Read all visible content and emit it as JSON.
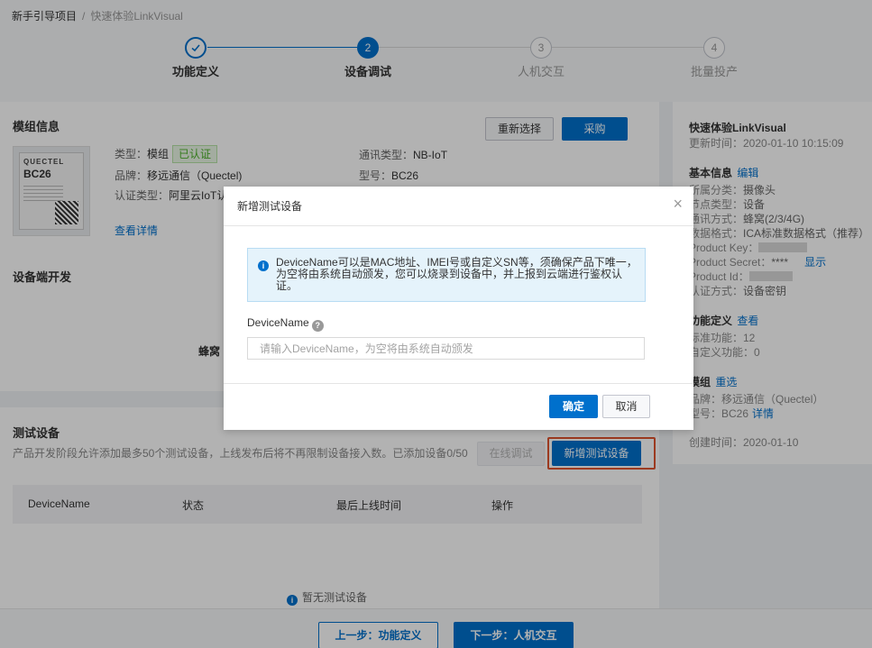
{
  "breadcrumb": {
    "project": "新手引导项目",
    "separator": "/",
    "current": "快速体验LinkVisual"
  },
  "steps": [
    {
      "num": "",
      "label": "功能定义",
      "state": "done"
    },
    {
      "num": "2",
      "label": "设备调试",
      "state": "active"
    },
    {
      "num": "3",
      "label": "人机交互",
      "state": "todo"
    },
    {
      "num": "4",
      "label": "批量投产",
      "state": "todo"
    }
  ],
  "module": {
    "title": "模组信息",
    "reselect_label": "重新选择",
    "buy_label": "采购",
    "chip_brand": "QUECTEL",
    "chip_model": "BC26",
    "type_label": "类型：",
    "type_value": "模组",
    "certified_tag": "已认证",
    "brand_label": "品牌：",
    "brand_value": "移远通信（Quectel)",
    "cert_type_label": "认证类型：",
    "cert_type_value": "阿里云IoT认",
    "comm_label": "通讯类型：",
    "comm_value": "NB-IoT",
    "model_label": "型号：",
    "model_value": "BC26",
    "details_link": "查看详情"
  },
  "device_dev": {
    "title": "设备端开发",
    "partial_text": "蜂窝"
  },
  "test_devices": {
    "title": "测试设备",
    "description": "产品开发阶段允许添加最多50个测试设备，上线发布后将不再限制设备接入数。已添加设备0/50",
    "online_debug_label": "在线调试",
    "add_device_label": "新增测试设备",
    "columns": [
      "DeviceName",
      "状态",
      "最后上线时间",
      "操作"
    ],
    "empty_text": "暂无测试设备"
  },
  "sidebar": {
    "title": "快速体验LinkVisual",
    "updated": "更新时间：2020-01-10 10:15:09",
    "basic_title": "基本信息",
    "edit_link": "编辑",
    "lines": [
      {
        "label": "所属分类：",
        "value": "摄像头"
      },
      {
        "label": "节点类型：",
        "value": "设备"
      },
      {
        "label": "通讯方式：",
        "value": "蜂窝(2/3/4G)"
      },
      {
        "label": "数据格式：",
        "value": "ICA标准数据格式（推荐）"
      }
    ],
    "product_key_label": "Product Key：",
    "product_secret_label": "Product Secret：",
    "product_secret_value": "****",
    "show_link": "显示",
    "product_id_label": "Product Id：",
    "auth_label": "认证方式：",
    "auth_value": "设备密钥",
    "func_title": "功能定义",
    "view_link": "查看",
    "std_func": "标准功能：12",
    "custom_func": "自定义功能：0",
    "module_title": "模组",
    "reselect_link": "重选",
    "module_brand": "品牌：移远通信（Quectel）",
    "module_model": "型号：BC26",
    "details_link": "详情",
    "created": "创建时间：2020-01-10"
  },
  "footer": {
    "prev_label": "上一步：功能定义",
    "next_label": "下一步：人机交互"
  },
  "modal": {
    "title": "新增测试设备",
    "close_symbol": "×",
    "alert_text": "DeviceName可以是MAC地址、IMEI号或自定义SN等，须确保产品下唯一，为空将由系统自动颁发，您可以烧录到设备中，并上报到云端进行鉴权认证。",
    "field_label": "DeviceName",
    "input_placeholder": "请输入DeviceName，为空将由系统自动颁发",
    "input_value": "",
    "confirm_label": "确定",
    "cancel_label": "取消"
  },
  "colors": {
    "primary": "#0070cc",
    "success": "#4cb12a",
    "highlight": "#e0532f"
  }
}
